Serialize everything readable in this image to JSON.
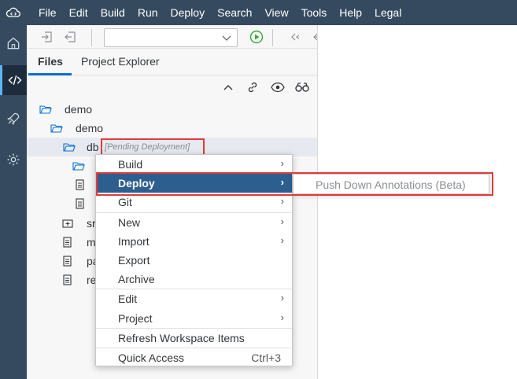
{
  "menubar": {
    "items": [
      "File",
      "Edit",
      "Build",
      "Run",
      "Deploy",
      "Search",
      "View",
      "Tools",
      "Help",
      "Legal"
    ]
  },
  "activity": {
    "icons": [
      "home-icon",
      "code-icon",
      "rocket-icon",
      "settings-icon"
    ]
  },
  "pane": {
    "tabs": [
      "Files",
      "Project Explorer"
    ],
    "active_tab": "Files"
  },
  "tree": {
    "items": [
      {
        "label": "demo",
        "icon": "folder-open-icon"
      },
      {
        "label": "demo",
        "icon": "folder-open-icon"
      },
      {
        "label": "db",
        "note": "[Pending Deployment]",
        "icon": "folder-open-icon"
      },
      {
        "label": "",
        "icon": "folder-open-icon"
      },
      {
        "label": "",
        "icon": "file-icon"
      },
      {
        "label": "",
        "icon": "file-icon"
      },
      {
        "label": "sr",
        "icon": "package-icon"
      },
      {
        "label": "m",
        "icon": "file-icon"
      },
      {
        "label": "pa",
        "icon": "file-icon"
      },
      {
        "label": "re",
        "icon": "file-icon"
      }
    ]
  },
  "context_menu": {
    "items": [
      {
        "label": "Build",
        "submenu": true
      },
      {
        "label": "Deploy",
        "submenu": true,
        "highlighted": true
      },
      {
        "label": "Git",
        "submenu": true
      },
      {
        "label": "New",
        "submenu": true
      },
      {
        "label": "Import",
        "submenu": true
      },
      {
        "label": "Export"
      },
      {
        "label": "Archive"
      },
      {
        "label": "Edit",
        "submenu": true
      },
      {
        "label": "Project",
        "submenu": true
      },
      {
        "label": "Refresh Workspace Items"
      },
      {
        "label": "Quick Access",
        "shortcut": "Ctrl+3"
      }
    ]
  },
  "submenu": {
    "items": [
      "Push Down Annotations (Beta)"
    ]
  },
  "colors": {
    "menubar_bg": "#354a5f",
    "highlight": "#2c5f8f",
    "annotation_red": "#e23a3a",
    "accent": "#0a6ed1"
  }
}
